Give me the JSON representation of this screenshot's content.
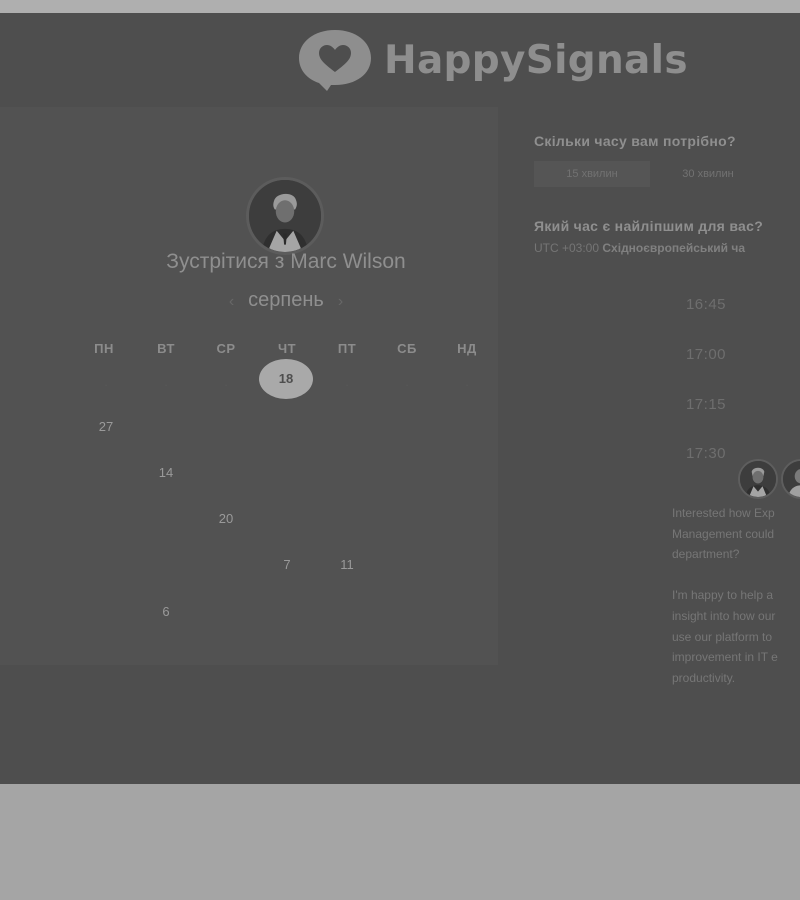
{
  "brand": {
    "name": "HappySignals",
    "logo_icon": "heart-speech-bubble-icon"
  },
  "calendar": {
    "meet_title": "Зустрітися з Marc Wilson",
    "month": "серпень",
    "prev_icon": "chevron-left-icon",
    "next_icon": "chevron-right-icon",
    "weekdays": [
      "ПН",
      "ВТ",
      "СР",
      "ЧТ",
      "ПТ",
      "СБ",
      "НД"
    ],
    "selected_day": "18",
    "available_days": [
      "27",
      "14",
      "20",
      "7",
      "11",
      "6"
    ]
  },
  "booking": {
    "duration_question": "Скільки часу вам потрібно?",
    "duration_options": [
      "15 хвилин",
      "30 хвилин"
    ],
    "time_question": "Який час є найліпшим для вас?",
    "timezone_offset": "UTC +03:00",
    "timezone_name": "Східноєвропейський ча",
    "time_slots": [
      "16:45",
      "17:00",
      "17:15",
      "17:30"
    ]
  },
  "host": {
    "description_lines": [
      "Interested how Exp",
      "Management could",
      "department?",
      "",
      "I'm happy to help a",
      "insight into how our",
      "use our platform to",
      "improvement in IT e",
      "productivity."
    ]
  },
  "colors": {
    "overlay": "#4e4e4e",
    "panel": "#525252",
    "selected": "#a9a9a9",
    "outer": "#a6a6a6"
  }
}
